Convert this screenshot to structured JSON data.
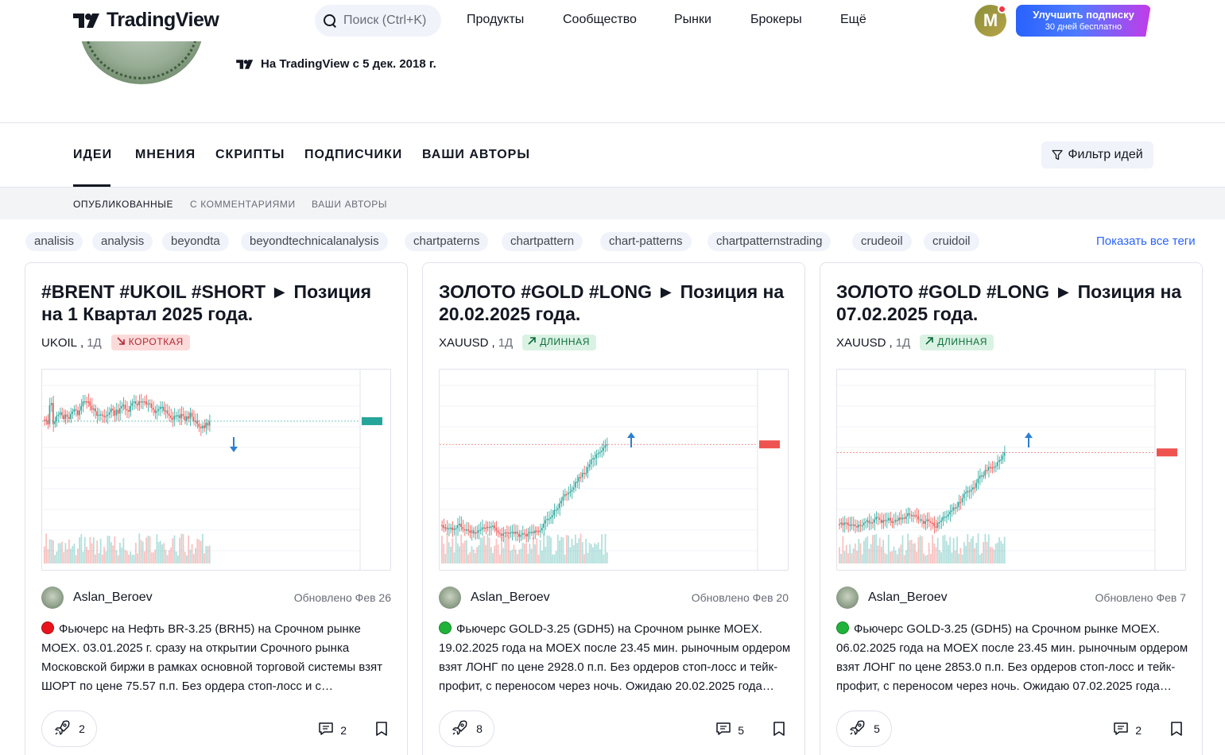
{
  "header": {
    "logo_text": "TradingView",
    "search_placeholder": "Поиск (Ctrl+K)",
    "nav": [
      "Продукты",
      "Сообщество",
      "Рынки",
      "Брокеры",
      "Ещё"
    ],
    "avatar_letter": "M",
    "upgrade_title": "Улучшить подписку",
    "upgrade_sub": "30 дней бесплатно"
  },
  "profile": {
    "joined": "На TradingView с 5 дек. 2018 г."
  },
  "tabs": [
    "ИДЕИ",
    "МНЕНИЯ",
    "СКРИПТЫ",
    "ПОДПИСЧИКИ",
    "ВАШИ АВТОРЫ"
  ],
  "filter_label": "Фильтр идей",
  "subtabs": [
    "ОПУБЛИКОВАННЫЕ",
    "С КОММЕНТАРИЯМИ",
    "ВАШИ АВТОРЫ"
  ],
  "tags": [
    "analisis",
    "analysis",
    "beyondta",
    "beyondtechnicalanalysis",
    "chartpaterns",
    "chartpattern",
    "chart-patterns",
    "chartpatternstrading",
    "crudeoil",
    "cruidoil"
  ],
  "show_all_tags": "Показать все теги",
  "cards": [
    {
      "title": "#BRENT #UKOIL #SHORT ► Позиция на 1 Квартал 2025 года.",
      "symbol": "UKOIL",
      "timeframe": "1Д",
      "direction": "КОРОТКАЯ",
      "direction_type": "short",
      "author": "Aslan_Beroev",
      "updated": "Обновлено Фев 26",
      "dot": "red",
      "description": "Фьючерс на Нефть BR-3.25 (BRH5) на Срочном рынке MOEX. 03.01.2025 г. сразу на открытии Срочного рынка Московской биржи в рамках основной торговой системы взят ШОРТ по цене 75.57 п.п. Без ордера стоп-лосс и с…",
      "boosts": "2",
      "comments": "2"
    },
    {
      "title": "ЗОЛОТО #GOLD #LONG ► Позиция на 20.02.2025 года.",
      "symbol": "XAUUSD",
      "timeframe": "1Д",
      "direction": "ДЛИННАЯ",
      "direction_type": "long",
      "author": "Aslan_Beroev",
      "updated": "Обновлено Фев 20",
      "dot": "green",
      "description": "Фьючерс GOLD-3.25 (GDH5) на Срочном рынке MOEX. 19.02.2025 года на MOEX после 23.45 мин. рыночным ордером взят ЛОНГ по цене 2928.0 п.п. Без ордеров стоп-лосс и тейк-профит, с переносом через ночь. Ожидаю 20.02.2025 года…",
      "boosts": "8",
      "comments": "5"
    },
    {
      "title": "ЗОЛОТО #GOLD #LONG ► Позиция на 07.02.2025 года.",
      "symbol": "XAUUSD",
      "timeframe": "1Д",
      "direction": "ДЛИННАЯ",
      "direction_type": "long",
      "author": "Aslan_Beroev",
      "updated": "Обновлено Фев 7",
      "dot": "green",
      "description": "Фьючерс GOLD-3.25 (GDH5) на Срочном рынке MOEX. 06.02.2025 года на MOEX после 23.45 мин. рыночным ордером взят ЛОНГ по цене 2853.0 п.п. Без ордеров стоп-лосс и тейк-профит, с переносом через ночь. Ожидаю 07.02.2025 года…",
      "boosts": "5",
      "comments": "2"
    }
  ],
  "colors": {
    "accent": "#2962ff",
    "up": "#26a69a",
    "down": "#ef5350",
    "short_badge": "#fcdada",
    "long_badge": "#daf2e3"
  }
}
